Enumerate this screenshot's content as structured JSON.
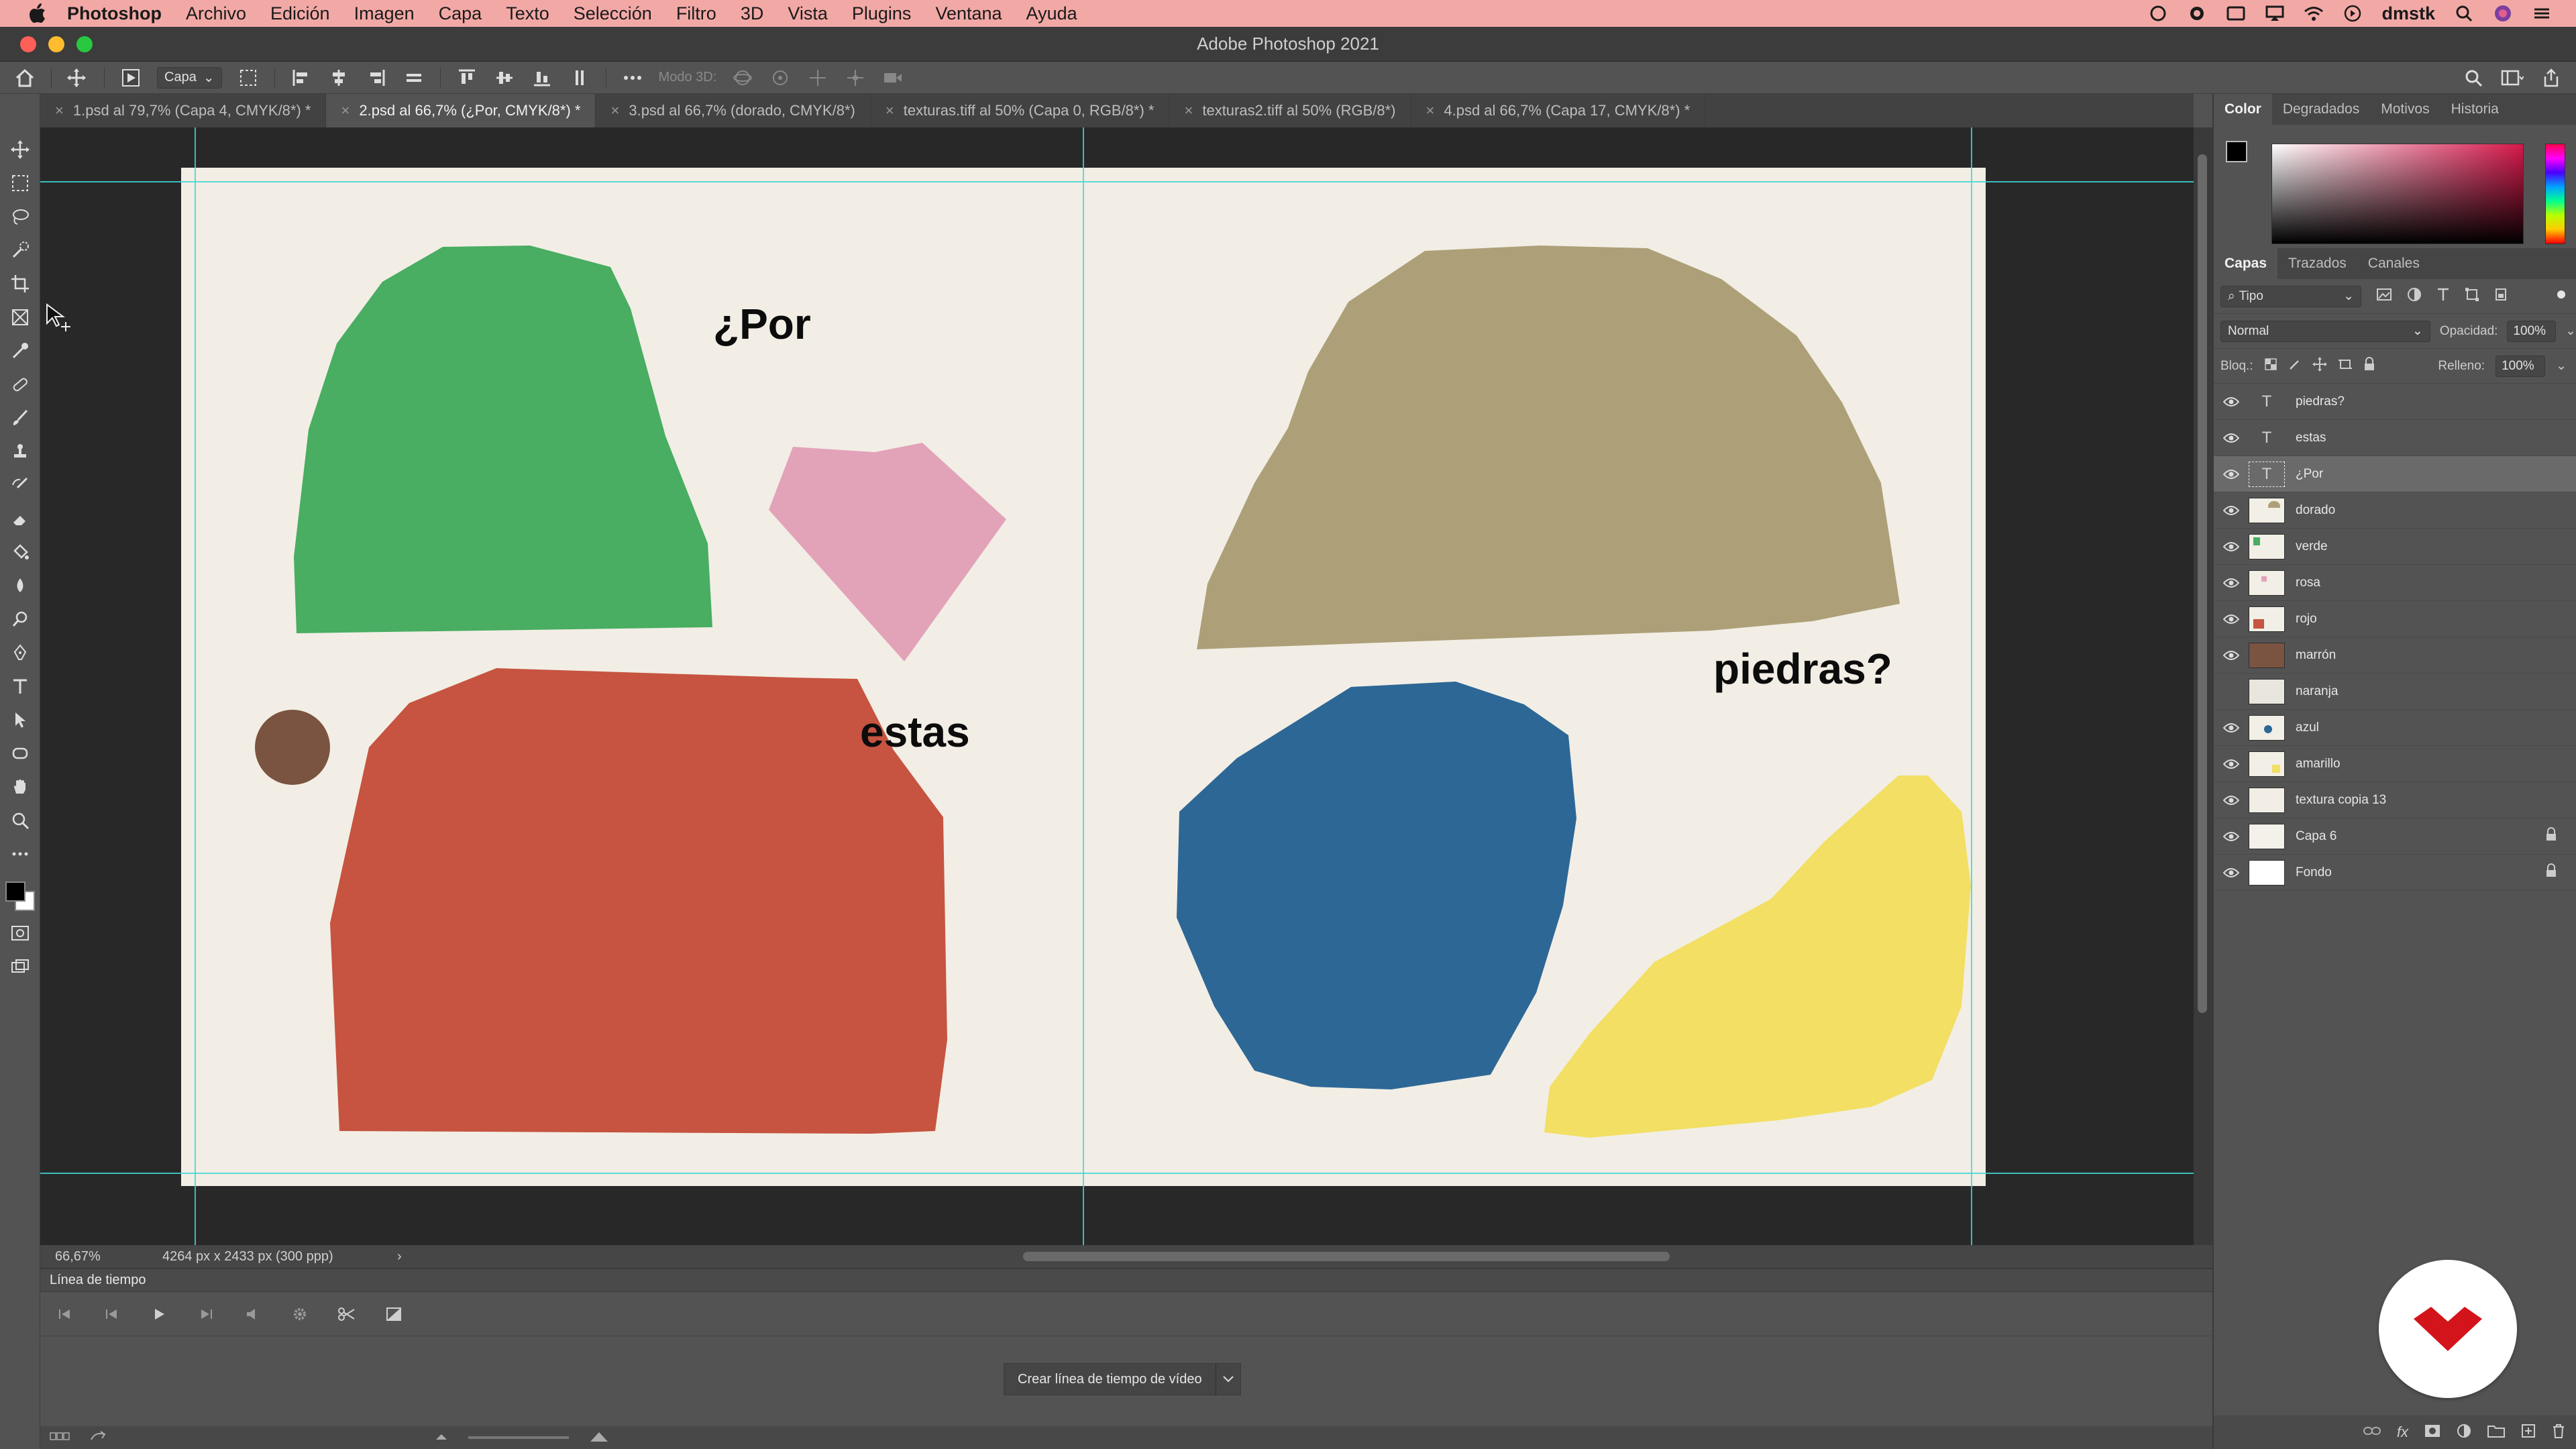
{
  "menubar": {
    "app_name": "Photoshop",
    "items": [
      "Archivo",
      "Edición",
      "Imagen",
      "Capa",
      "Texto",
      "Selección",
      "Filtro",
      "3D",
      "Vista",
      "Plugins",
      "Ventana",
      "Ayuda"
    ],
    "user": "dmstk"
  },
  "window": {
    "title": "Adobe Photoshop 2021"
  },
  "options": {
    "auto_select_target": "Capa",
    "mode_3d_label": "Modo 3D:"
  },
  "tabs": [
    {
      "label": "1.psd al 79,7% (Capa 4, CMYK/8*) *",
      "active": false
    },
    {
      "label": "2.psd al 66,7% (¿Por, CMYK/8*) *",
      "active": true
    },
    {
      "label": "3.psd al 66,7% (dorado, CMYK/8*)",
      "active": false
    },
    {
      "label": "texturas.tiff al 50% (Capa 0, RGB/8*) *",
      "active": false
    },
    {
      "label": "texturas2.tiff al 50% (RGB/8*)",
      "active": false
    },
    {
      "label": "4.psd al 66,7% (Capa 17, CMYK/8*) *",
      "active": false
    }
  ],
  "canvas": {
    "text_por": "¿Por",
    "text_estas": "estas",
    "text_piedras": "piedras?",
    "shape_colors": {
      "green": "#49ad62",
      "pink": "#e2a3b9",
      "brown": "#7a5440",
      "red": "#c65440",
      "gold": "#ad9f78",
      "blue": "#2d6796",
      "yellow": "#f2df63"
    }
  },
  "status": {
    "zoom": "66,67%",
    "dimensions": "4264 px x 2433 px (300 ppp)"
  },
  "timeline": {
    "title": "Línea de tiempo",
    "create_button": "Crear línea de tiempo de vídeo"
  },
  "color_panel": {
    "tabs": [
      "Color",
      "Degradados",
      "Motivos",
      "Historia"
    ],
    "foreground": "#000000",
    "background": "#ffffff"
  },
  "layers_panel": {
    "tabs": [
      "Capas",
      "Trazados",
      "Canales"
    ],
    "filter_kind": "Tipo",
    "blend_mode": "Normal",
    "opacity_label": "Opacidad:",
    "opacity": "100%",
    "lock_label": "Bloq.:",
    "fill_label": "Relleno:",
    "fill": "100%",
    "layers": [
      {
        "name": "piedras?",
        "kind": "text",
        "visible": true,
        "selected": false,
        "locked": false
      },
      {
        "name": "estas",
        "kind": "text",
        "visible": true,
        "selected": false,
        "locked": false
      },
      {
        "name": "¿Por",
        "kind": "text",
        "visible": true,
        "selected": true,
        "locked": false
      },
      {
        "name": "dorado",
        "kind": "pixel",
        "visible": true,
        "selected": false,
        "locked": false,
        "thumb_color": "#ad9f78"
      },
      {
        "name": "verde",
        "kind": "pixel",
        "visible": true,
        "selected": false,
        "locked": false,
        "thumb_color": "#49ad62"
      },
      {
        "name": "rosa",
        "kind": "pixel",
        "visible": true,
        "selected": false,
        "locked": false,
        "thumb_color": "#e2a3b9"
      },
      {
        "name": "rojo",
        "kind": "pixel",
        "visible": true,
        "selected": false,
        "locked": false,
        "thumb_color": "#c65440"
      },
      {
        "name": "marrón",
        "kind": "pixel",
        "visible": true,
        "selected": false,
        "locked": false,
        "thumb_color": "#7a5440"
      },
      {
        "name": "naranja",
        "kind": "pixel",
        "visible": false,
        "selected": false,
        "locked": false,
        "thumb_color": "#e9e6de"
      },
      {
        "name": "azul",
        "kind": "pixel",
        "visible": true,
        "selected": false,
        "locked": false,
        "thumb_color": "#2d6796"
      },
      {
        "name": "amarillo",
        "kind": "pixel",
        "visible": true,
        "selected": false,
        "locked": false,
        "thumb_color": "#f2df63"
      },
      {
        "name": "textura copia 13",
        "kind": "pixel",
        "visible": true,
        "selected": false,
        "locked": false,
        "thumb_color": "#f2eee5"
      },
      {
        "name": "Capa 6",
        "kind": "pixel",
        "visible": true,
        "selected": false,
        "locked": true,
        "thumb_color": "#f4f1ea"
      },
      {
        "name": "Fondo",
        "kind": "pixel",
        "visible": true,
        "selected": false,
        "locked": true,
        "thumb_color": "#ffffff"
      }
    ]
  }
}
